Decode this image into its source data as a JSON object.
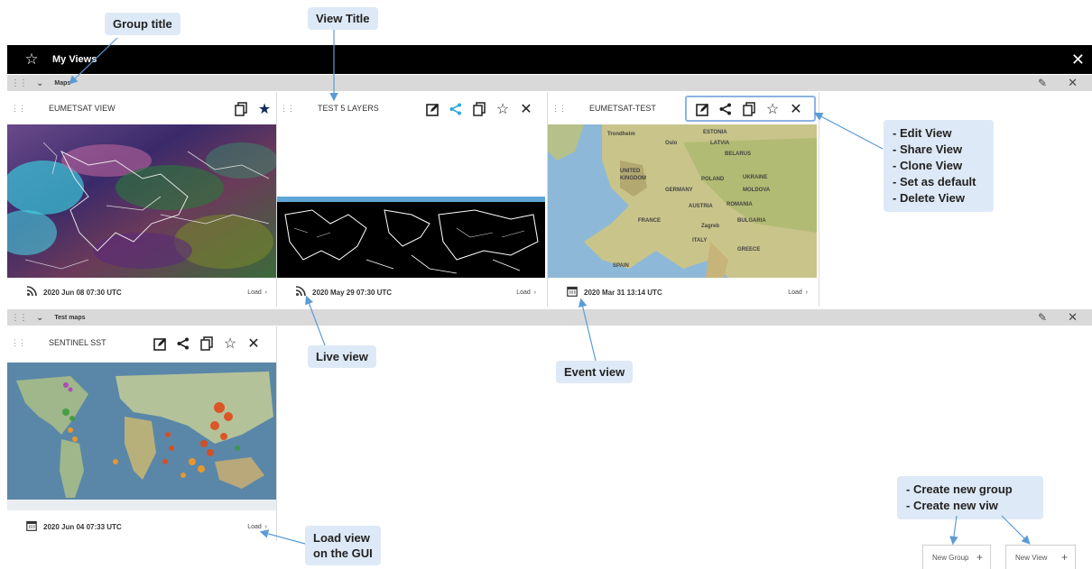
{
  "topbar": {
    "title": "My Views",
    "star_icon": "star-outline-icon",
    "close_icon": "close-icon"
  },
  "groups": [
    {
      "title": "Maps"
    },
    {
      "title": "Test maps"
    }
  ],
  "views": [
    {
      "title": "EUMETSAT VIEW",
      "date": "2020 Jun 08 07:30 UTC",
      "type_icon": "rss-live-icon",
      "load": "Load",
      "default": true
    },
    {
      "title": "TEST 5 LAYERS",
      "date": "2020 May 29 07:30 UTC",
      "type_icon": "rss-live-icon",
      "load": "Load",
      "default": false
    },
    {
      "title": "EUMETSAT-TEST",
      "date": "2020 Mar 31 13:14 UTC",
      "type_icon": "calendar-icon",
      "load": "Load",
      "default": false
    },
    {
      "title": "SENTINEL SST",
      "date": "2020 Jun 04 07:33 UTC",
      "type_icon": "calendar-icon",
      "load": "Load",
      "default": false
    }
  ],
  "callouts": {
    "group_title": "Group title",
    "view_title": "View Title",
    "live_view": "Live view",
    "event_view": "Event view",
    "load_view_1": "Load view",
    "load_view_2": "on the GUI",
    "actions": [
      "Edit View",
      "Share View",
      "Clone View",
      "Set as default",
      "Delete View"
    ],
    "create": [
      "Create new group",
      "Create new viw"
    ]
  },
  "buttons": {
    "new_group": "New Group",
    "new_view": "New View"
  },
  "map_labels": [
    "Trondheim",
    "Oslo",
    "ESTONIA",
    "LATVIA",
    "BELARUS",
    "UNITED KINGDOM",
    "POLAND",
    "UKRAINE",
    "GERMANY",
    "MOLDOVA",
    "AUSTRIA",
    "ROMANIA",
    "FRANCE",
    "Zagreb",
    "BULGARIA",
    "ITALY",
    "GREECE",
    "SPAIN"
  ],
  "colors": {
    "accent": "#2aa7e0",
    "callout_bg": "#dde9f6",
    "arrow": "#5b9bd5",
    "star_default": "#0f2b5b"
  }
}
